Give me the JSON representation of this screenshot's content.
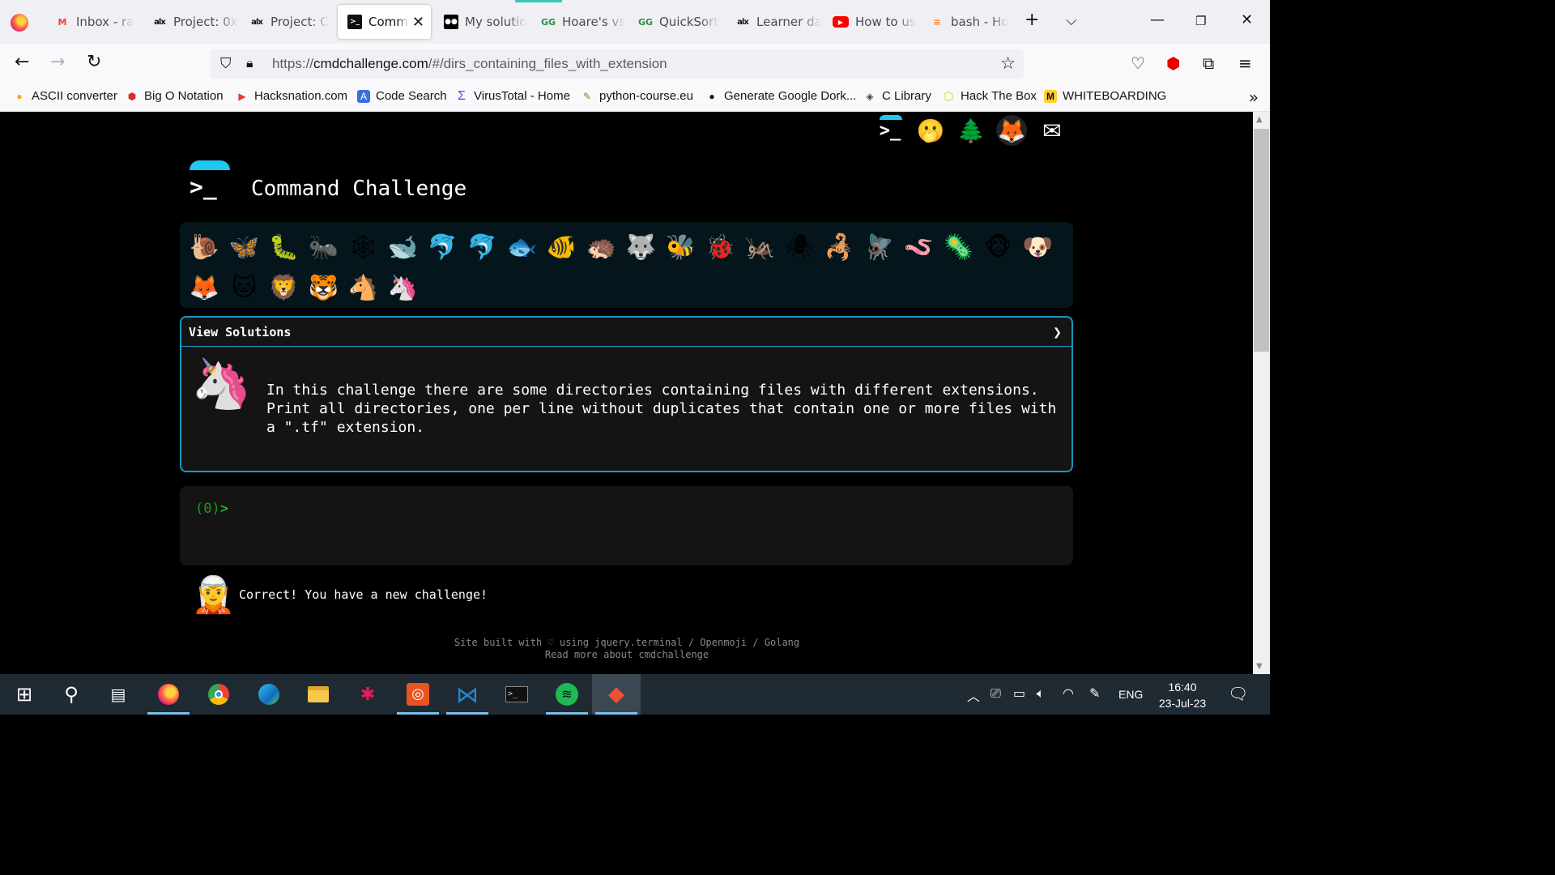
{
  "browser": {
    "tabs": [
      {
        "title": "Inbox - ra",
        "icon": "gmail-icon",
        "glyph": "M"
      },
      {
        "title": "Project: 0x",
        "icon": "alx-icon",
        "glyph": "alx"
      },
      {
        "title": "Project: C",
        "icon": "alx-icon",
        "glyph": "alx"
      },
      {
        "title": "Comma",
        "icon": "terminal-icon",
        "glyph": ">_"
      },
      {
        "title": "My solutio",
        "icon": "medium-icon",
        "glyph": "●●"
      },
      {
        "title": "Hoare's vs",
        "icon": "gfg-icon",
        "glyph": "GG"
      },
      {
        "title": "QuickSort",
        "icon": "gfg-icon",
        "glyph": "GG"
      },
      {
        "title": "Learner da",
        "icon": "alx-icon",
        "glyph": "alx"
      },
      {
        "title": "How to us",
        "icon": "youtube-icon",
        "glyph": "▶"
      },
      {
        "title": "bash - Ho",
        "icon": "stackoverflow-icon",
        "glyph": "≡"
      }
    ],
    "new_tab": "+",
    "tab_list": "⌵",
    "url_prefix": "https://",
    "url_host": "cmdchallenge.com",
    "url_path": "/#/dirs_containing_files_with_extension",
    "bookmarks": [
      {
        "label": "ASCII converter",
        "glyph": "●",
        "color": "#f6a623"
      },
      {
        "label": "Big O Notation",
        "glyph": "⬢",
        "color": "#d32f2f"
      },
      {
        "label": "Hacksnation.com",
        "glyph": "▶",
        "color": "#e53935"
      },
      {
        "label": "Code Search",
        "glyph": "A",
        "color": "#3b6fe0"
      },
      {
        "label": "VirusTotal - Home",
        "glyph": "Σ",
        "color": "#394eff"
      },
      {
        "label": "python-course.eu",
        "glyph": "✎",
        "color": "#6b8e23"
      },
      {
        "label": "Generate Google Dork...",
        "glyph": "●",
        "color": "#111111"
      },
      {
        "label": "C Library",
        "glyph": "◈",
        "color": "#444444"
      },
      {
        "label": "Hack The Box",
        "glyph": "⬡",
        "color": "#9fef00"
      },
      {
        "label": "WHITEBOARDING",
        "glyph": "M",
        "color": "#ffd02f"
      }
    ],
    "bookmarks_overflow": "»"
  },
  "page": {
    "title": "Command Challenge",
    "logo_prompt": ">_",
    "top_icons": [
      "terminal-icon",
      "face-icon",
      "tree-icon",
      "gitlab-icon",
      "mail-icon"
    ],
    "animals": [
      "🐌",
      "🦋",
      "🐛",
      "🐜",
      "🕸",
      "🐋",
      "🐬",
      "🐬",
      "🐟",
      "🐠",
      "🦔",
      "🐺",
      "🐝",
      "🐞",
      "🦗",
      "🕷",
      "🦂",
      "🪰",
      "🪱",
      "🦠",
      "🐵",
      "🐶",
      "🦊",
      "🐱",
      "🦁",
      "🐯",
      "🐴",
      "🦄"
    ],
    "solutions_label": "View Solutions",
    "challenge_text": "In this challenge there are some directories containing files with different extensions. Print all directories, one per line without duplicates that contain one or more files with a \".tf\" extension.",
    "prompt_count": "(0)",
    "prompt_symbol": ">",
    "feedback_message": "Correct! You have a new challenge!",
    "footer_line1": "Site built with ♡ using jquery.terminal / Openmoji / Golang",
    "footer_line2": "Read more about cmdchallenge"
  },
  "taskbar": {
    "apps": [
      "start-icon",
      "search-icon",
      "task-view-icon",
      "firefox-icon",
      "chrome-icon",
      "edge-icon",
      "file-explorer-icon",
      "slack-icon",
      "ubuntu-icon",
      "vscode-icon",
      "terminal-icon",
      "spotify-icon",
      "git-icon"
    ],
    "language": "ENG",
    "time": "16:40",
    "date": "23-Jul-23"
  }
}
